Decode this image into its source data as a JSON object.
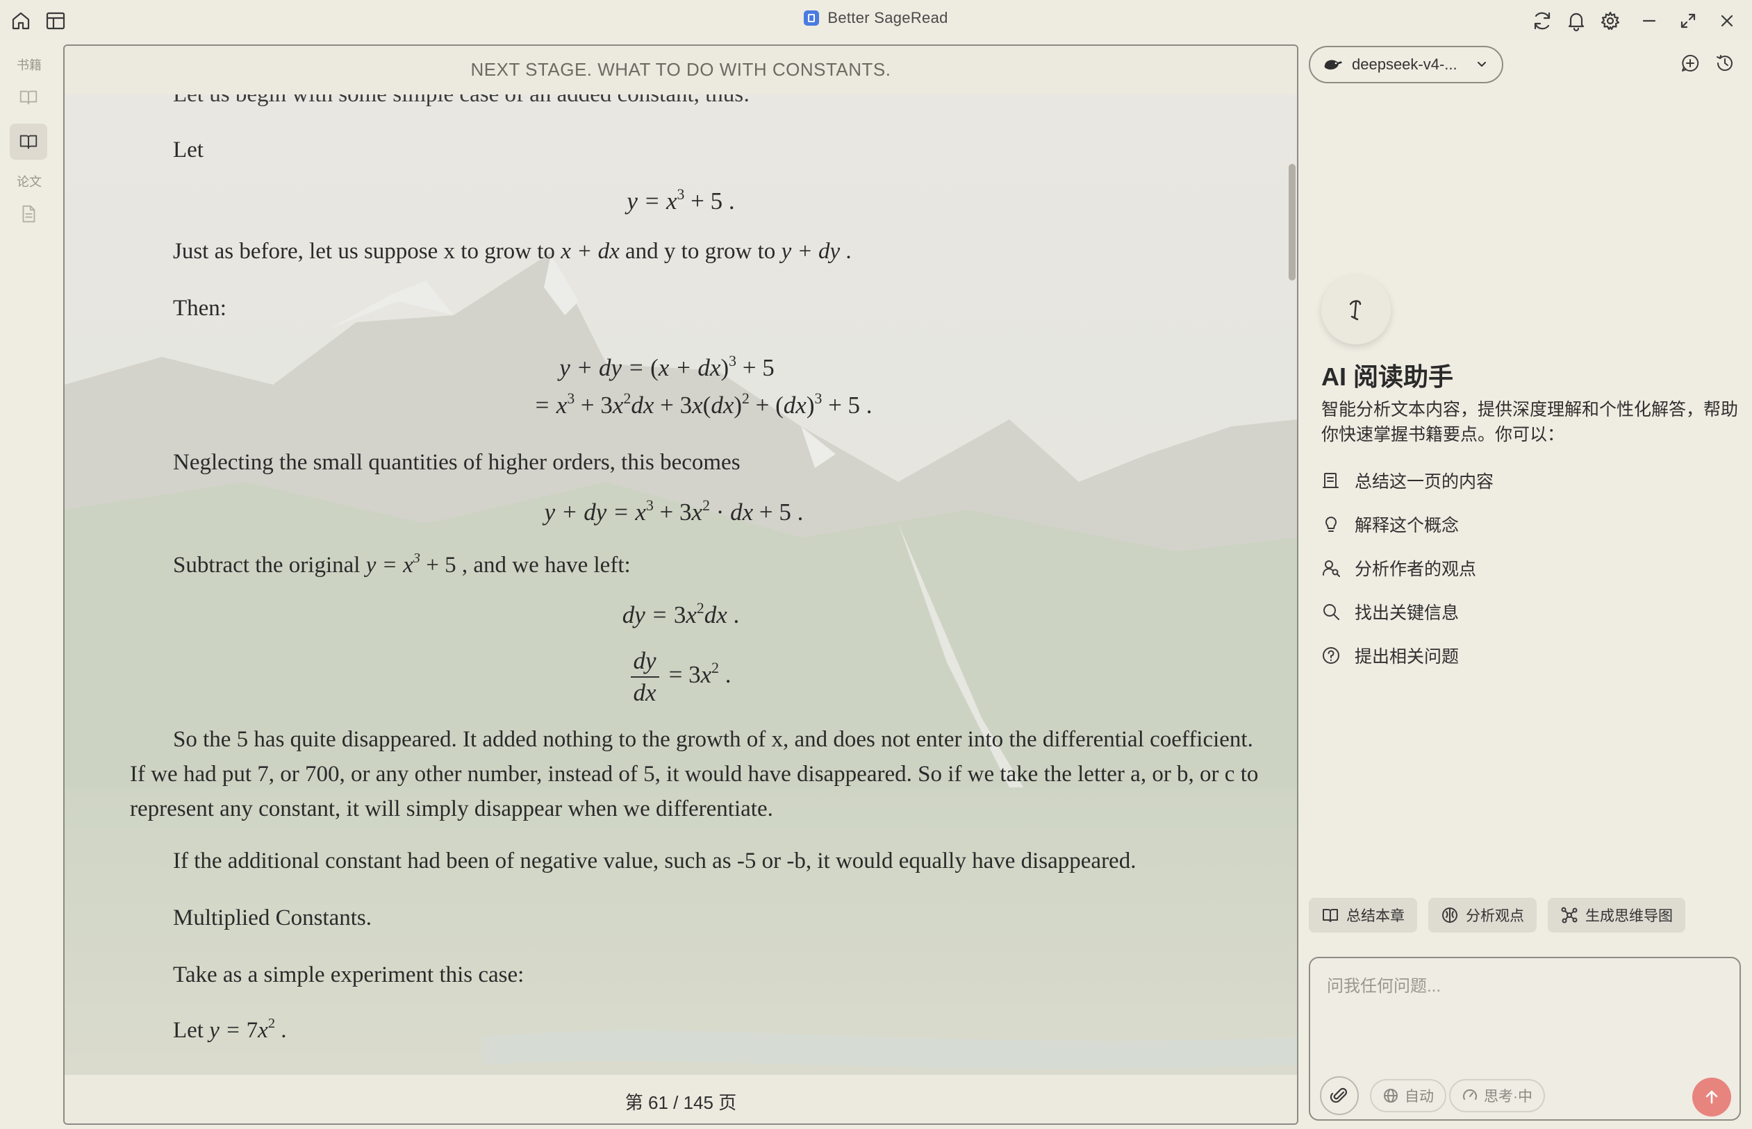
{
  "app": {
    "title": "Better SageRead"
  },
  "sidebar": {
    "books_label": "书籍",
    "papers_label": "论文"
  },
  "reader": {
    "chapter_header": "NEXT STAGE. WHAT TO DO WITH CONSTANTS.",
    "page_indicator": "第 61 / 145 页",
    "intro_cut": "Let us begin with some simple case of an added constant, thus:",
    "let_word": "Let",
    "eq1": "y = x³ + 5 .",
    "grow_text_start": "Just as before, let us suppose x to grow to ",
    "grow_x": "x + dx",
    "grow_mid": " and y to grow to ",
    "grow_y": "y + dy",
    "grow_end": " .",
    "then_word": "Then:",
    "neglect_text": "Neglecting the small quantities of higher orders, this becomes",
    "subtract_start": "Subtract the original ",
    "subtract_end": " , and we have left:",
    "para_disappeared": "So the 5 has quite disappeared. It added nothing to the growth of x, and does not enter into the differential coefficient. If we had put 7, or 700, or any other number, instead of 5, it would have disappeared. So if we take the letter a, or b, or c to represent any constant, it will simply disappear when we differentiate.",
    "para_negative": "If the additional constant had been of negative value, such as -5 or -b, it would equally have disappeared.",
    "multiplied_heading": "Multiplied Constants.",
    "experiment_text": "Take as a simple experiment this case:",
    "let_last": "Let "
  },
  "assistant": {
    "model_name": "deepseek-v4-...",
    "title": "AI 阅读助手",
    "description": "智能分析文本内容，提供深度理解和个性化解答，帮助你快速掌握书籍要点。你可以：",
    "suggestions": [
      {
        "label": "总结这一页的内容",
        "icon": "summary-list-icon"
      },
      {
        "label": "解释这个概念",
        "icon": "lightbulb-icon"
      },
      {
        "label": "分析作者的观点",
        "icon": "user-search-icon"
      },
      {
        "label": "找出关键信息",
        "icon": "search-icon"
      },
      {
        "label": "提出相关问题",
        "icon": "question-circle-icon"
      }
    ],
    "quick_actions": [
      "总结本章",
      "分析观点",
      "生成思维导图"
    ],
    "input_placeholder": "问我任何问题...",
    "auto_label": "自动",
    "thinking_label": "思考·中"
  },
  "colors": {
    "send_button": "#e8847e",
    "background": "#efece2"
  }
}
